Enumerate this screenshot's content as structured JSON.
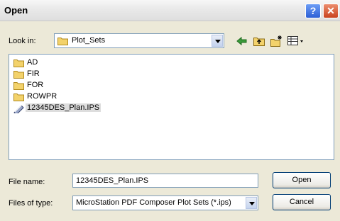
{
  "window": {
    "title": "Open",
    "help_label": "?",
    "close_label": "✕"
  },
  "look_in": {
    "label": "Look in:",
    "value": "Plot_Sets"
  },
  "file_list": {
    "items": [
      {
        "label": "AD",
        "type": "folder"
      },
      {
        "label": "FIR",
        "type": "folder"
      },
      {
        "label": "FOR",
        "type": "folder"
      },
      {
        "label": "ROWPR",
        "type": "folder"
      },
      {
        "label": "12345DES_Plan.IPS",
        "type": "file",
        "selected": true
      }
    ]
  },
  "file_name": {
    "label": "File name:",
    "value": "12345DES_Plan.IPS"
  },
  "file_type": {
    "label": "Files of type:",
    "value": "MicroStation PDF Composer Plot Sets (*.ips)"
  },
  "buttons": {
    "open": "Open",
    "cancel": "Cancel"
  },
  "icons": {
    "back": "back-arrow-icon",
    "up": "up-folder-icon",
    "new_folder": "new-folder-icon",
    "views": "views-menu-icon",
    "folder": "folder-icon",
    "file": "plot-file-icon"
  },
  "colors": {
    "dialog_bg": "#ece9d8",
    "input_border": "#7f9db9",
    "close_red": "#c9431f",
    "help_blue": "#2d5fd6",
    "folder_yellow": "#f3d26b"
  }
}
